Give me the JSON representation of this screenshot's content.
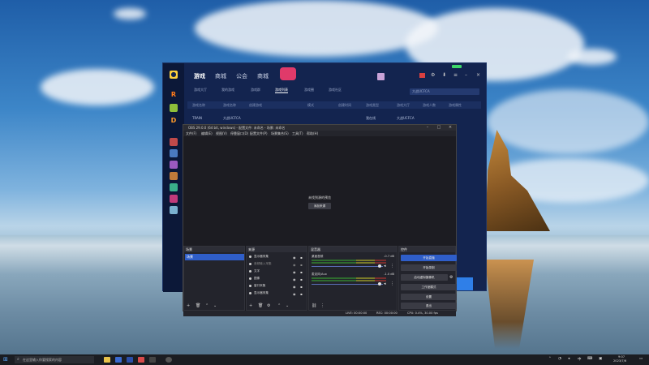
{
  "game": {
    "nav": [
      "游戏",
      "商城",
      "公会",
      "商城"
    ],
    "tabs": [
      "游戏大厅",
      "我的游戏",
      "游戏群",
      "游戏列表",
      "游戏圈",
      "游戏社区"
    ],
    "search_placeholder": "大战UCFCA",
    "table_headers": [
      "游戏名称",
      "游戏名称",
      "创建游戏",
      "模式",
      "创建时间",
      "游戏类型",
      "游戏大厅",
      "游戏人数",
      "游戏属性"
    ],
    "row": [
      "TRAIN",
      "大战UCFCA",
      "我在线",
      "大战UCFCA"
    ]
  },
  "obs": {
    "title": "OBS 29.0.0 (64 bit, windows) - 配置文件: 未命名 - 场景: 未命名",
    "menu": [
      "文件(F)",
      "编辑(E)",
      "视图(V)",
      "停靠窗口(D)",
      "配置文件(P)",
      "场景集合(S)",
      "工具(T)",
      "帮助(H)"
    ],
    "preview_message": "未找到源的预览",
    "preview_button": "添加来源",
    "docks": {
      "scenes": "场景",
      "sources": "来源",
      "mixer": "混音器",
      "controls": "控件"
    },
    "scene_item": "场景",
    "sources": [
      "显示器采集",
      "音频输入采集",
      "文字",
      "图像",
      "窗口采集",
      "显示器采集"
    ],
    "mixer": [
      {
        "name": "桌面音频",
        "db": "-0.7 dB"
      },
      {
        "name": "麦克风/Aux",
        "db": "-1.0 dB"
      }
    ],
    "controls": [
      "开始直播",
      "开始录制",
      "启动虚拟摄像机",
      "工作室模式",
      "设置",
      "退出"
    ],
    "status": {
      "live": "LIVE: 00:00:00",
      "rec": "REC: 00:00:00",
      "cpu": "CPU: 0.4%, 30.00 fps"
    }
  },
  "taskbar": {
    "search_text": "在这里输入你要搜索的内容",
    "time": "9:07",
    "date": "2023/7/6"
  }
}
